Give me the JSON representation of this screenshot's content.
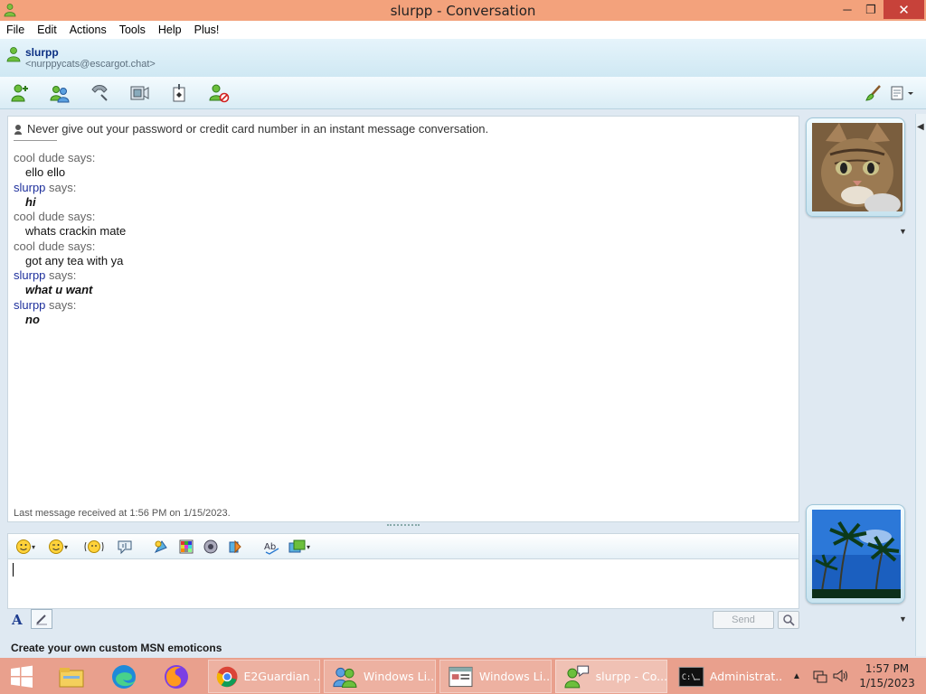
{
  "window": {
    "title": "slurpp - Conversation",
    "minimize": "─",
    "maximize": "❐",
    "close": "✕"
  },
  "menu": [
    "File",
    "Edit",
    "Actions",
    "Tools",
    "Help",
    "Plus!"
  ],
  "contact": {
    "name": "slurpp",
    "email": "<nurppycats@escargot.chat>"
  },
  "toolbar_icons": [
    "invite-contact-icon",
    "share-files-icon",
    "voice-call-icon",
    "video-icon",
    "games-icon",
    "block-icon",
    "background-brush-icon",
    "layout-menu-icon"
  ],
  "conversation": {
    "warning": "Never give out your password or credit card number in an instant message conversation.",
    "messages": [
      {
        "sender": "cool dude",
        "says": " says:",
        "text": "ello ello",
        "self": false
      },
      {
        "sender": "slurpp",
        "says": " says:",
        "text": "hi",
        "self": true
      },
      {
        "sender": "cool dude",
        "says": " says:",
        "text": "whats crackin mate",
        "self": false
      },
      {
        "sender": "cool dude",
        "says": " says:",
        "text": "got any tea with ya",
        "self": false
      },
      {
        "sender": "slurpp",
        "says": " says:",
        "text": "what u want",
        "self": true
      },
      {
        "sender": "slurpp",
        "says": " says:",
        "text": "no",
        "self": true
      }
    ],
    "last_message": "Last message received at 1:56 PM on 1/15/2023."
  },
  "compose": {
    "value": "",
    "font_label": "A",
    "send_label": "Send"
  },
  "status_text": "Create your own custom MSN emoticons",
  "display_pictures": {
    "contact": "kitten-photo",
    "self": "palm-trees-photo"
  },
  "taskbar": {
    "tasks": [
      {
        "label": "E2Guardian ..."
      },
      {
        "label": "Windows Li..."
      },
      {
        "label": "Windows Li..."
      },
      {
        "label": "slurpp - Co..."
      },
      {
        "label": "Administrat..."
      }
    ],
    "time": "1:57 PM",
    "date": "1/15/2023"
  },
  "colors": {
    "titlebar": "#f3a27c",
    "taskbar": "#e9a08d",
    "self_name": "#1d2f9c",
    "contact_name": "#0b2f83"
  }
}
